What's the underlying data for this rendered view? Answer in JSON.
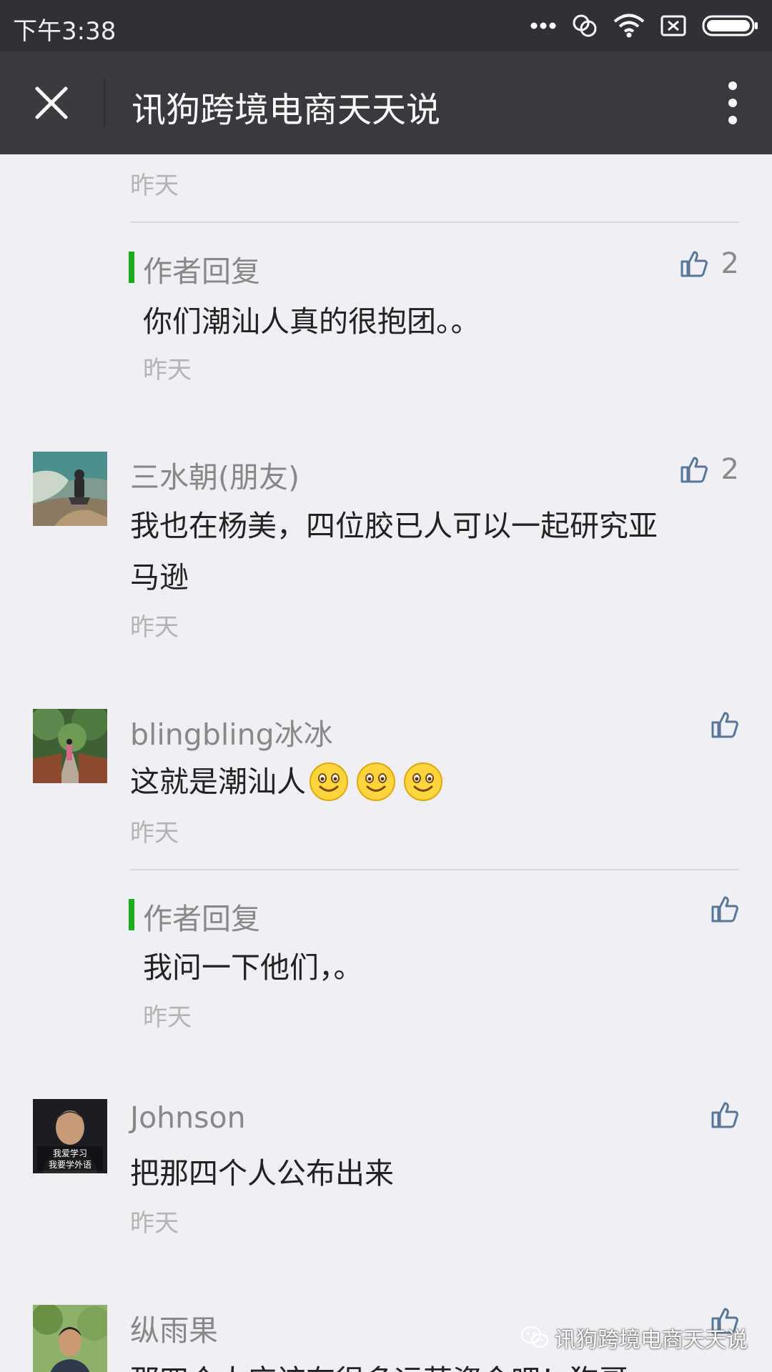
{
  "status_bar": {
    "time": "下午3:38"
  },
  "header": {
    "title": "讯狗跨境电商天天说"
  },
  "comments": [
    {
      "time": "昨天"
    },
    {
      "type": "author-reply",
      "name": "作者回复",
      "text": "你们潮汕人真的很抱团。。",
      "time": "昨天",
      "likes": "2"
    },
    {
      "name": "三水朝(朋友)",
      "text_line1": "我也在杨美，四位胶已人可以一起研究亚",
      "text_line2": "马逊",
      "time": "昨天",
      "likes": "2"
    },
    {
      "name": "blingbling冰冰",
      "text": "这就是潮汕人",
      "emoji_count": 3,
      "time": "昨天"
    },
    {
      "type": "author-reply",
      "name": "作者回复",
      "text": "我问一下他们，。",
      "time": "昨天"
    },
    {
      "name": "Johnson",
      "avatar_caption_1": "我爱学习",
      "avatar_caption_2": "我要学外语",
      "text": "把那四个人公布出来",
      "time": "昨天"
    },
    {
      "name": "纵雨果",
      "text": "那四个人应该有很多运营资金吧！狗哥"
    }
  ],
  "watermark": {
    "text": "讯狗跨境电商天天说"
  },
  "colors": {
    "status_bar": "#2f3136",
    "title_bar": "#393a3f",
    "background": "#efeff4",
    "reply_accent": "#1aad19",
    "like_icon": "#57769a"
  }
}
